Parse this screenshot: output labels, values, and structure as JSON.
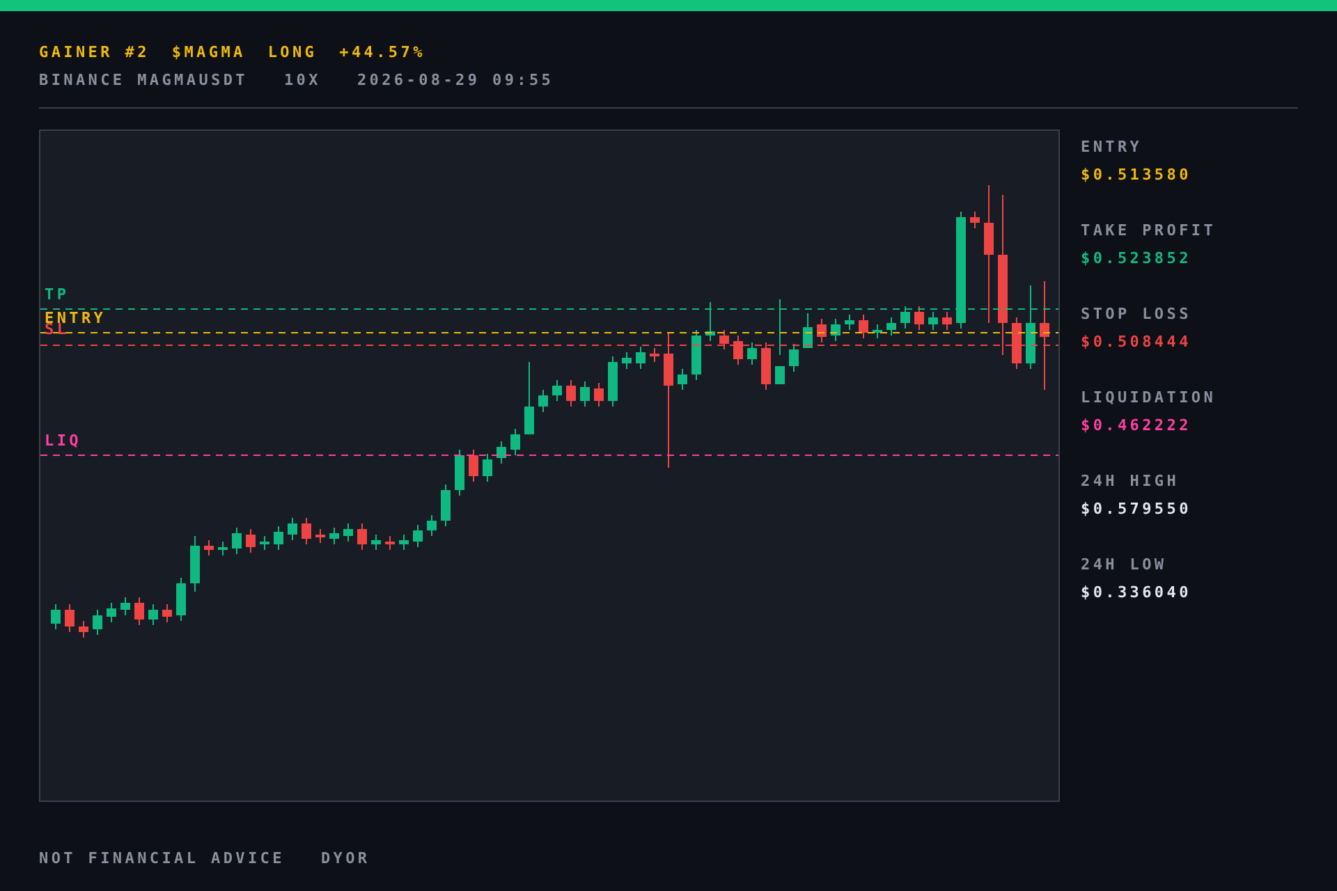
{
  "header": {
    "title": [
      {
        "text": "GAINER #2"
      },
      {
        "text": "$MAGMA"
      },
      {
        "text": "LONG"
      },
      {
        "text": "+44.57%"
      }
    ],
    "subtitle": [
      {
        "text": "BINANCE MAGMAUSDT"
      },
      {
        "text": "10X"
      },
      {
        "text": "2026-08-29 09:55"
      }
    ]
  },
  "chart": {
    "levels": [
      {
        "label": "TP",
        "color": "#10b981"
      },
      {
        "label": "ENTRY",
        "color": "#f0b90b"
      },
      {
        "label": "SL",
        "color": "#ef4444"
      },
      {
        "label": "LIQ",
        "color": "#ff3fa4"
      }
    ]
  },
  "stats": [
    {
      "label": "ENTRY",
      "value": "$0.513580",
      "color": "#f0b90b"
    },
    {
      "label": "TAKE PROFIT",
      "value": "$0.523852",
      "color": "#10b981"
    },
    {
      "label": "STOP LOSS",
      "value": "$0.508444",
      "color": "#ef4444"
    },
    {
      "label": "LIQUIDATION",
      "value": "$0.462222",
      "color": "#ff3fa4"
    },
    {
      "label": "24H HIGH",
      "value": "$0.579550",
      "color": "#e5e7eb"
    },
    {
      "label": "24H LOW",
      "value": "$0.336040",
      "color": "#e5e7eb"
    }
  ],
  "footer": [
    {
      "text": "NOT FINANCIAL ADVICE"
    },
    {
      "text": "DYOR"
    }
  ]
}
